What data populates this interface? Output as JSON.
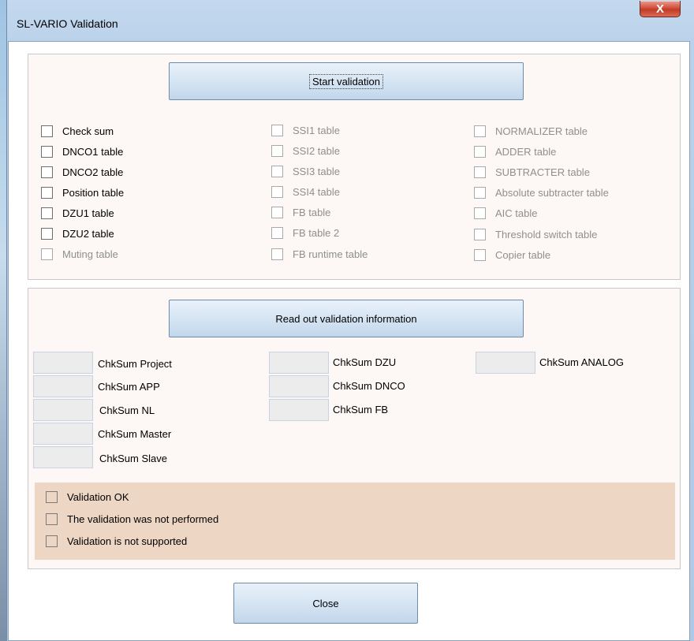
{
  "window": {
    "title": "SL-VARIO Validation",
    "close_glyph": "X"
  },
  "validation": {
    "start_button": "Start validation",
    "col1": [
      {
        "label": "Check sum",
        "enabled": true
      },
      {
        "label": "DNCO1 table",
        "enabled": true
      },
      {
        "label": "DNCO2 table",
        "enabled": true
      },
      {
        "label": "Position table",
        "enabled": true
      },
      {
        "label": "DZU1 table",
        "enabled": true
      },
      {
        "label": "DZU2 table",
        "enabled": true
      },
      {
        "label": "Muting table",
        "enabled": false
      }
    ],
    "col2": [
      {
        "label": "SSI1 table",
        "enabled": false
      },
      {
        "label": "SSI2 table",
        "enabled": false
      },
      {
        "label": "SSI3 table",
        "enabled": false
      },
      {
        "label": "SSI4 table",
        "enabled": false
      },
      {
        "label": "FB table",
        "enabled": false
      },
      {
        "label": "FB table 2",
        "enabled": false
      },
      {
        "label": "FB runtime table",
        "enabled": false
      }
    ],
    "col3": [
      {
        "label": "NORMALIZER table",
        "enabled": false
      },
      {
        "label": "ADDER table",
        "enabled": false
      },
      {
        "label": "SUBTRACTER table",
        "enabled": false
      },
      {
        "label": "Absolute subtracter table",
        "enabled": false
      },
      {
        "label": "AIC table",
        "enabled": false
      },
      {
        "label": "Threshold switch table",
        "enabled": false
      },
      {
        "label": "Copier table",
        "enabled": false
      }
    ]
  },
  "readout": {
    "button": "Read out validation information",
    "checksums_col1": [
      {
        "label": "ChkSum Project",
        "value": ""
      },
      {
        "label": "ChkSum APP",
        "value": ""
      },
      {
        "label": "ChkSum NL",
        "value": ""
      },
      {
        "label": "ChkSum Master",
        "value": ""
      },
      {
        "label": "ChkSum Slave",
        "value": ""
      }
    ],
    "checksums_col2": [
      {
        "label": "ChkSum DZU",
        "value": ""
      },
      {
        "label": "ChkSum DNCO",
        "value": ""
      },
      {
        "label": "ChkSum FB",
        "value": ""
      }
    ],
    "checksums_col3": [
      {
        "label": "ChkSum ANALOG",
        "value": ""
      }
    ],
    "status": [
      {
        "label": "Validation OK"
      },
      {
        "label": "The validation was not performed"
      },
      {
        "label": "Validation is not supported"
      }
    ],
    "status_background": "#eed6c4"
  },
  "footer": {
    "close_button": "Close"
  }
}
